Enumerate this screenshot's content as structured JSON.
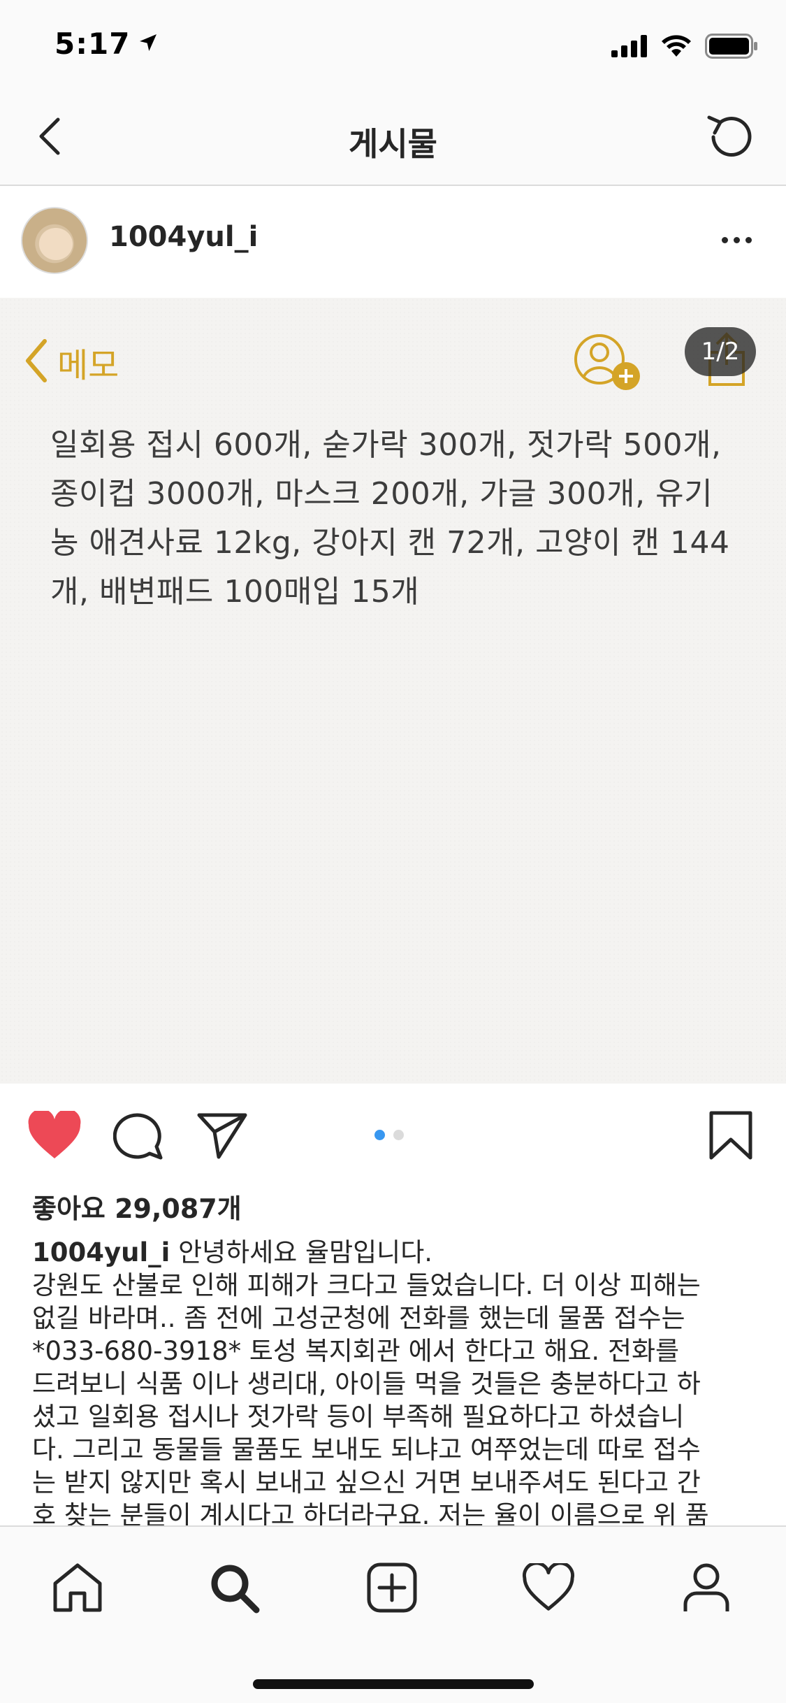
{
  "status_bar": {
    "time": "5:17",
    "icons": [
      "location-arrow-icon",
      "cellular-signal-icon",
      "wifi-icon",
      "battery-icon"
    ]
  },
  "nav": {
    "title": "게시물",
    "back_icon": "chevron-left-icon",
    "refresh_icon": "refresh-icon"
  },
  "post": {
    "username": "1004yul_i",
    "more_icon": "more-horizontal-icon",
    "image": {
      "memo_back_label": "메모",
      "page_indicator": "1/2",
      "memo_text": "일회용 접시 600개, 숟가락 300개, 젓가락 500개, 종이컵 3000개, 마스크 200개, 가글 300개, 유기농 애견사료 12kg, 강아지 캔 72개, 고양이 캔 144개, 배변패드 100매입 15개",
      "memo_lines": [
        "일회용 접시 600개, 숟가락 300개, 젓가락 500개,",
        "종이컵 3000개, 마스크 200개, 가글 300개, 유기",
        "농 애견사료 12kg, 강아지 캔 72개, 고양이 캔 144",
        "개, 배변패드 100매입 15개"
      ]
    },
    "actions": {
      "like_icon": "heart-filled-icon",
      "comment_icon": "comment-icon",
      "share_icon": "paper-plane-icon",
      "save_icon": "bookmark-icon",
      "carousel": {
        "count": 2,
        "active_index": 0
      }
    },
    "likes_text": "좋아요 29,087개",
    "caption_username": "1004yul_i",
    "caption_first": " 안녕하세요 율맘입니다.",
    "caption_lines": [
      "강원도 산불로 인해 피해가 크다고 들었습니다. 더 이상 피해는",
      "없길 바라며.. 좀 전에 고성군청에 전화를 했는데 물품 접수는",
      "*033-680-3918* 토성 복지회관 에서 한다고 해요. 전화를",
      "드려보니 식품 이나 생리대, 아이들 먹을 것들은 충분하다고 하",
      "셨고 일회용 접시나 젓가락 등이 부족해 필요하다고 하셨습니",
      "다. 그리고 동물들 물품도 보내도 되냐고 여쭈었는데 따로 접수",
      "는 받지 않지만 혹시 보내고 싶으신 거면 보내주셔도 된다고 간",
      "호 찾는 분들이 계시다고 하더라구요. 저는 율이 이름으로 위 품"
    ]
  },
  "tab_bar": {
    "tabs": [
      "home-icon",
      "search-icon",
      "add-post-icon",
      "activity-heart-icon",
      "profile-icon"
    ],
    "active": "search-icon"
  },
  "colors": {
    "like_red": "#ed4956",
    "memo_gold": "#d4a427",
    "carousel_active": "#3897f0",
    "carousel_inactive": "#dbdbdb"
  }
}
